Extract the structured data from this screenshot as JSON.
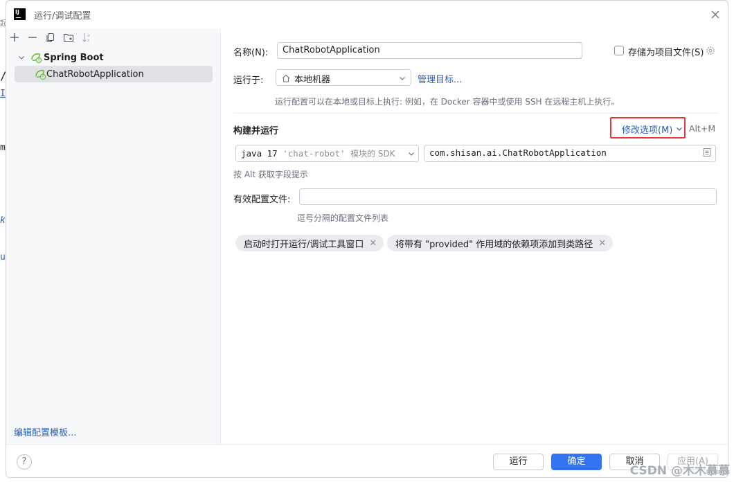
{
  "window": {
    "title": "运行/调试配置",
    "logo_text": "IJ"
  },
  "bg_fragments": [
    "起",
    "/",
    "I",
    "m",
    "k",
    "u"
  ],
  "sidebar": {
    "toolbar": [
      "add-icon",
      "remove-icon",
      "copy-icon",
      "new-folder-icon",
      "sort-icon"
    ],
    "tree": {
      "group": {
        "label": "Spring Boot"
      },
      "item": {
        "label": "ChatRobotApplication"
      }
    },
    "edit_templates": "编辑配置模板..."
  },
  "form": {
    "name_label": "名称(N):",
    "name_value": "ChatRobotApplication",
    "store_label": "存储为项目文件(S)",
    "run_on_label": "运行于:",
    "run_on_value": "本地机器",
    "manage_targets": "管理目标...",
    "run_on_hint": "运行配置可以在本地或目标上执行: 例如，在 Docker 容器中或使用 SSH 在远程主机上执行。",
    "build_run_label": "构建并运行",
    "modify_options": "修改选项(M)",
    "modify_shortcut": "Alt+M",
    "jdk_java": "java 17",
    "jdk_module": "'chat-robot'",
    "jdk_suffix": "模块的 SDK",
    "main_class": "com.shisan.ai.ChatRobotApplication",
    "alt_hint": "按 Alt 获取字段提示",
    "profiles_label": "有效配置文件:",
    "profiles_value": "",
    "profiles_hint": "逗号分隔的配置文件列表",
    "chips": [
      "启动时打开运行/调试工具窗口",
      "将带有 \"provided\" 作用域的依赖项添加到类路径"
    ]
  },
  "footer": {
    "help": "?",
    "run": "运行",
    "ok": "确定",
    "cancel": "取消",
    "apply": "应用(A)"
  },
  "watermark": "CSDN @木木慕慕",
  "colors": {
    "accent": "#3574f0",
    "link": "#2c5fb4",
    "highlight_box": "#e53935"
  }
}
